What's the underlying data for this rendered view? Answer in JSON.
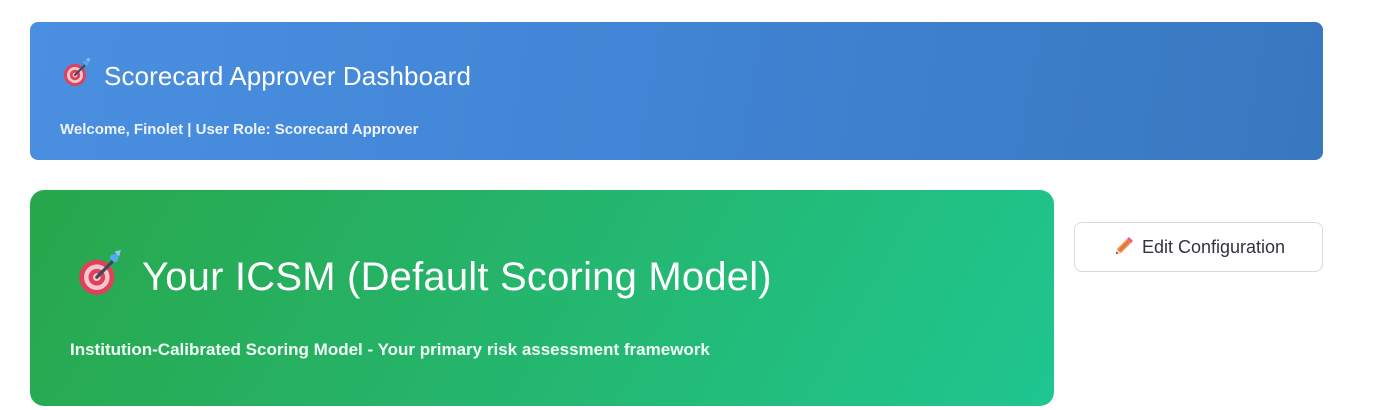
{
  "header": {
    "icon": "dart-target-icon",
    "title": "Scorecard Approver Dashboard",
    "subtitle": "Welcome, Finolet | User Role: Scorecard Approver"
  },
  "model_card": {
    "icon": "dart-target-icon",
    "title": "Your ICSM (Default Scoring Model)",
    "subtitle": "Institution-Calibrated Scoring Model - Your primary risk assessment framework"
  },
  "actions": {
    "edit_icon": "pencil-icon",
    "edit_label": "Edit Configuration"
  },
  "colors": {
    "header_gradient_start": "#4a8fe0",
    "header_gradient_end": "#3878bf",
    "card_gradient_start": "#28a74b",
    "card_gradient_end": "#1fc690",
    "button_border": "#d6d9de"
  }
}
